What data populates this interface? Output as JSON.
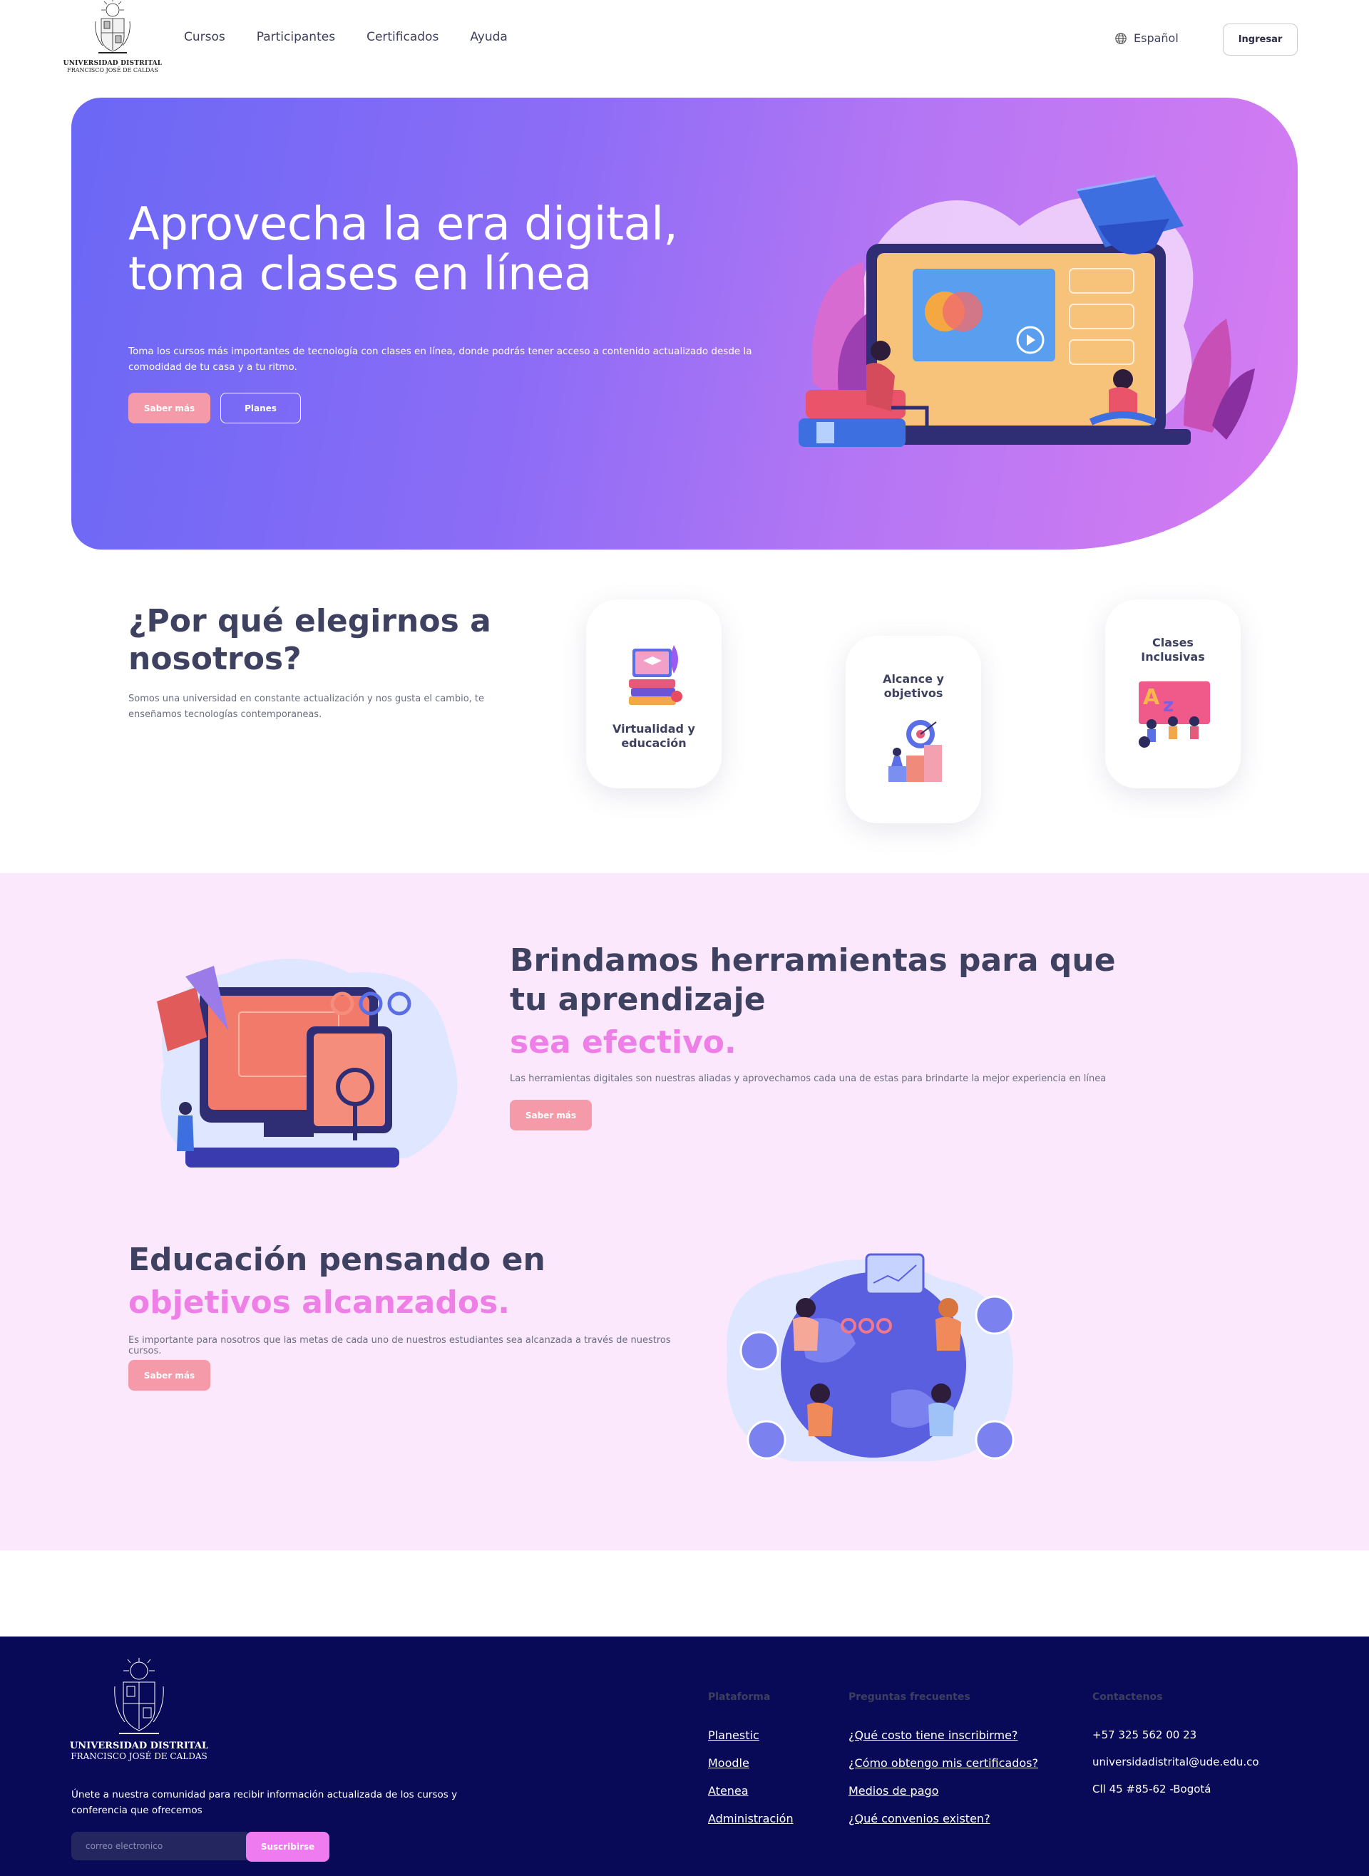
{
  "header": {
    "logo_line1": "UNIVERSIDAD DISTRITAL",
    "logo_line2": "FRANCISCO JOSÉ DE CALDAS",
    "nav": [
      "Cursos",
      "Participantes",
      "Certificados",
      "Ayuda"
    ],
    "language": "Español",
    "login_label": "Ingresar"
  },
  "hero": {
    "title_line1": "Aprovecha la era digital,",
    "title_line2": "toma clases en línea",
    "description": "Toma los cursos más importantes de tecnología con clases en línea, donde podrás tener acceso a contenido actualizado desde la comodidad de tu casa y a tu ritmo.",
    "primary_button": "Saber más",
    "secondary_button": "Planes",
    "gradient_start": "#6a68f5",
    "gradient_end": "#d77cf1"
  },
  "why": {
    "title": "¿Por qué elegirnos a nosotros?",
    "text": "Somos una universidad en constante actualización y nos gusta el cambio, te enseñamos tecnologías contemporaneas.",
    "cards": [
      {
        "label": "Virtualidad y educación",
        "icon": "laptop-graduation-icon"
      },
      {
        "label": "Alcance y objetivos",
        "icon": "target-steps-icon"
      },
      {
        "label": "Clases Inclusivas",
        "icon": "classroom-az-icon"
      }
    ]
  },
  "tools": {
    "title": "Brindamos herramientas para que tu aprendizaje",
    "accent": "sea efectivo.",
    "text": "Las herramientas digitales son nuestras aliadas y aprovechamos cada una de estas para brindarte la mejor experiencia en línea",
    "button": "Saber más"
  },
  "education": {
    "title": "Educación pensando en",
    "accent": "objetivos alcanzados.",
    "text": "Es importante para nosotros que las metas de cada uno de nuestros estudiantes sea alcanzada a través de nuestros cursos.",
    "button": "Saber más"
  },
  "footer": {
    "logo_line1": "UNIVERSIDAD DISTRITAL",
    "logo_line2": "FRANCISCO JOSÉ DE CALDAS",
    "join_text": "Únete a nuestra comunidad para recibir información actualizada de los cursos y conferencia que ofrecemos",
    "email_placeholder": "correo electronico",
    "subscribe_label": "Suscribirse",
    "plataforma": {
      "title": "Plataforma",
      "links": [
        "Planestic",
        "Moodle",
        "Atenea",
        "Administración"
      ]
    },
    "faq": {
      "title": "Preguntas frecuentes",
      "links": [
        "¿Qué costo tiene inscribirme?",
        "¿Cómo obtengo mis certificados?",
        "Medios de pago",
        "¿Qué convenios existen?"
      ]
    },
    "contact": {
      "title": "Contactenos",
      "items": [
        "+57 325 562 00 23",
        "universidadistrital@ude.edu.co",
        "Cll 45 #85-62 -Bogotá"
      ]
    },
    "background": "#080a57"
  },
  "colors": {
    "accent_pink": "#ed7fe6",
    "button_pink": "#f59aa8",
    "band_bg": "#fbe8fc",
    "heading": "#3f4160"
  }
}
